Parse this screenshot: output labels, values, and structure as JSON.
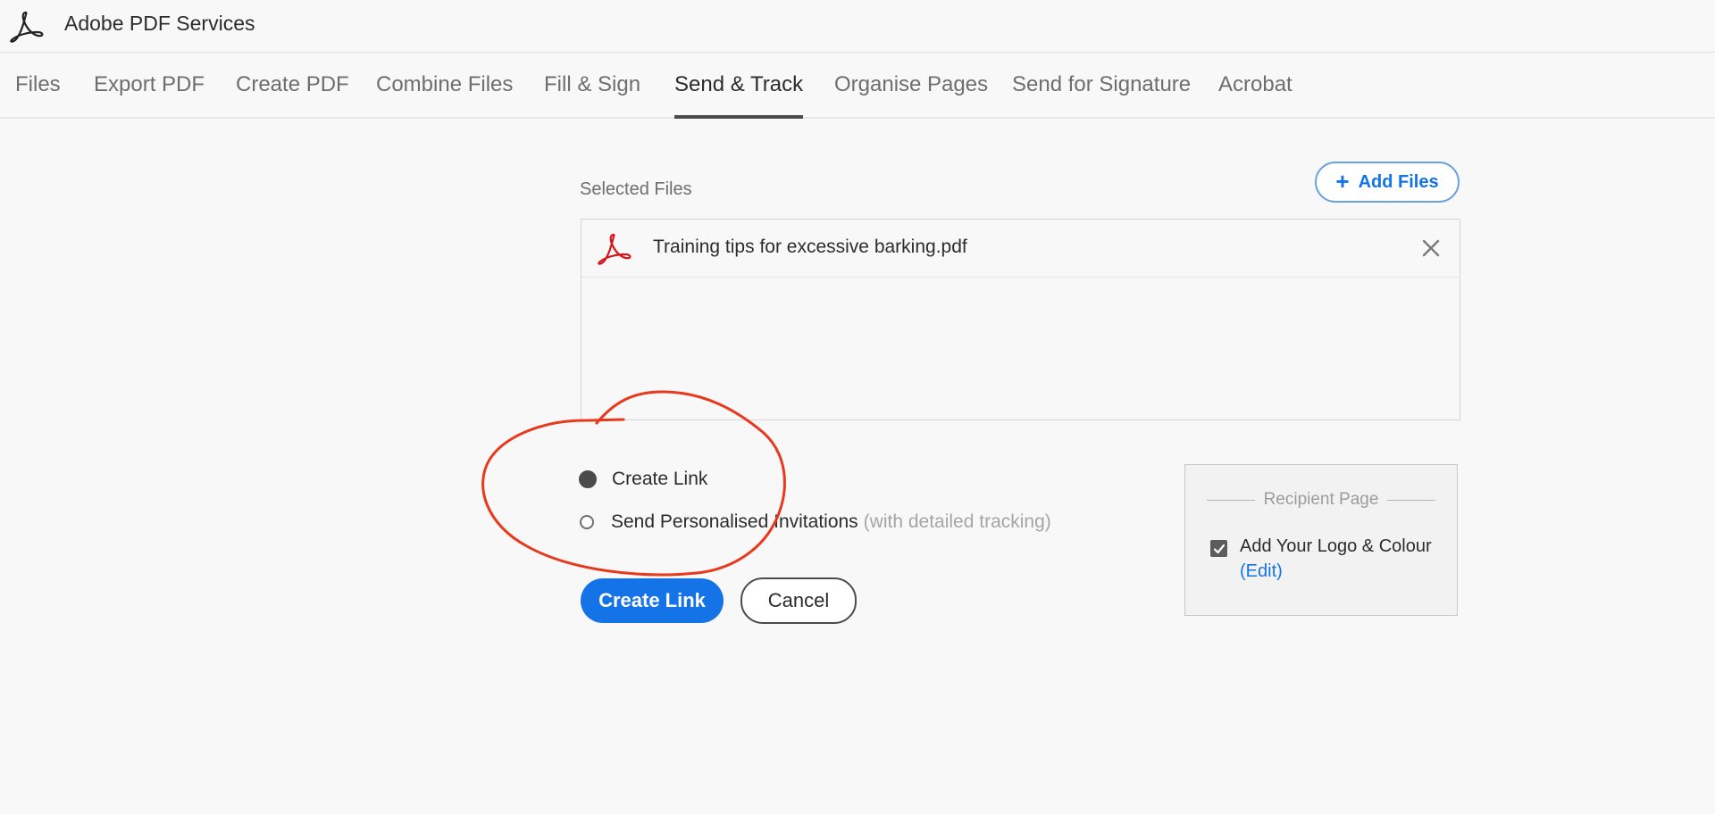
{
  "app": {
    "title": "Adobe PDF Services",
    "logo_icon": "acrobat-logo-icon"
  },
  "tabs": [
    {
      "label": "Files",
      "active": false
    },
    {
      "label": "Export PDF",
      "active": false
    },
    {
      "label": "Create PDF",
      "active": false
    },
    {
      "label": "Combine Files",
      "active": false
    },
    {
      "label": "Fill & Sign",
      "active": false
    },
    {
      "label": "Send & Track",
      "active": true
    },
    {
      "label": "Organise Pages",
      "active": false
    },
    {
      "label": "Send for Signature",
      "active": false
    },
    {
      "label": "Acrobat",
      "active": false
    }
  ],
  "main": {
    "selected_files_label": "Selected Files",
    "add_files_label": "Add Files",
    "files": [
      {
        "name": "Training tips for excessive barking.pdf",
        "icon": "pdf-file-icon"
      }
    ],
    "options": {
      "create_link": {
        "label": "Create Link",
        "selected": true
      },
      "send_invitations": {
        "label": "Send Personalised Invitations",
        "hint": "(with detailed tracking)",
        "selected": false
      }
    },
    "create_button_label": "Create Link",
    "cancel_button_label": "Cancel"
  },
  "recipient_page": {
    "title": "Recipient Page",
    "logo_colour_label": "Add Your Logo & Colour",
    "logo_colour_checked": true,
    "edit_label": "(Edit)"
  },
  "colors": {
    "accent": "#1473e6",
    "annotation": "#e8391c",
    "pdf_red": "#d7141a"
  }
}
